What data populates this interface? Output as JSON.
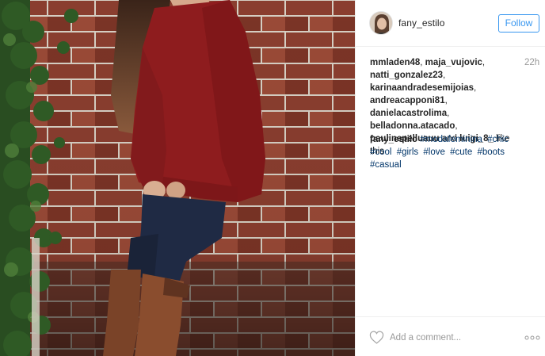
{
  "post": {
    "username": "fany_estilo",
    "follow_label": "Follow",
    "time_ago": "22h",
    "likers": [
      "mmladen48",
      "maja_vujovic",
      "natti_gonzalez23",
      "karinaandradesemijoias",
      "andreacapponi81",
      "danielacastrolima",
      "belladonna.atacado",
      "paulinepelluauu"
    ],
    "likers_sep": ", ",
    "likers_and": " and ",
    "likers_last": "luigi_8_",
    "likes_suffix": " like this",
    "caption_author": "fany_estilo",
    "hashtags": [
      "#modafeminina",
      "#chic",
      "#cool",
      "#girls",
      "#love",
      "#cute",
      "#boots",
      "#casual"
    ],
    "comment_placeholder": "Add a comment...",
    "photo_alt": "photo"
  },
  "icons": {
    "avatar": "avatar",
    "like": "heart-outline-icon",
    "more": "more-options-icon"
  },
  "colors": {
    "follow": "#3897f0",
    "hashtag": "#003569",
    "muted": "#999999",
    "text": "#262626",
    "sweater": "#8e1c1e",
    "jeans": "#1f2a44",
    "boots": "#7a4328"
  }
}
